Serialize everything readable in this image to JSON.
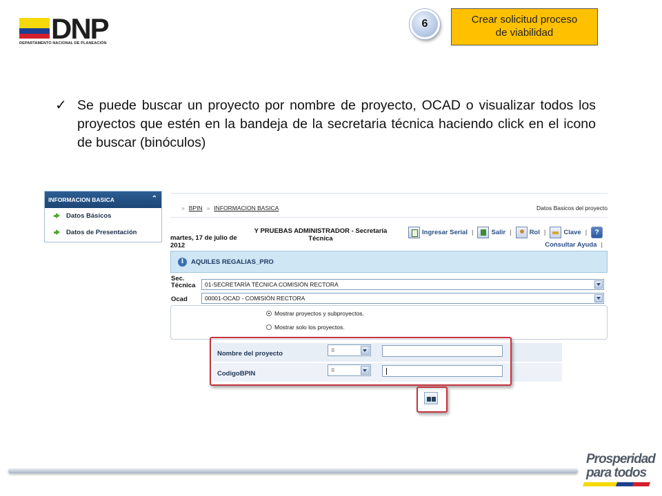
{
  "header": {
    "logo_text": "DNP",
    "logo_subtitle": "DEPARTAMENTO NACIONAL DE PLANEACIÓN",
    "step_number": "6",
    "step_title_line1": "Crear solicitud proceso",
    "step_title_line2": "de viabilidad"
  },
  "bullet": {
    "text": "Se puede buscar un proyecto por nombre de proyecto, OCAD o visualizar todos los proyectos que estén en la bandeja de la secretaria técnica haciendo click en el icono de buscar (binóculos)"
  },
  "sidebar": {
    "header": "INFORMACION BASICA",
    "collapse_glyph": "⌃",
    "items": [
      {
        "label": "Datos Básicos"
      },
      {
        "label": "Datos de Presentación"
      }
    ]
  },
  "app": {
    "breadcrumb": [
      "BPIN",
      "INFORMACION BASICA"
    ],
    "breadcrumb_sep": "»",
    "page_title": "Datos Basicos del proyecto",
    "date_line1": "martes, 17 de julio de",
    "date_line2": "2012",
    "user_line1": "Y PRUEBAS ADMINISTRADOR - Secretaría",
    "user_line2": "Técnica",
    "toolbar": {
      "ingresar_serial": "Ingresar Serial",
      "salir": "Salir",
      "rol": "Rol",
      "clave": "Clave",
      "separator": "|",
      "consultar_ayuda": "Consultar Ayuda"
    },
    "info_bar": "AQUILES REGALIAS_PRO",
    "sec_tecnica_label_1": "Sec.",
    "sec_tecnica_label_2": "Técnica",
    "sec_tecnica_value": "01-SECRETARÍA TÉCNICA COMISIÓN RECTORA",
    "ocad_label": "Ocad",
    "ocad_value": "00001-OCAD - COMISIÓN RECTORA",
    "radio_options": [
      {
        "label": "Mostrar proyectos y subproyectos.",
        "selected": true
      },
      {
        "label": "Mostrar solo los proyectos.",
        "selected": false
      }
    ],
    "search_rows": [
      {
        "label": "Nombre del proyecto",
        "operator": "=",
        "value": ""
      },
      {
        "label": "CodigoBPIN",
        "operator": "=",
        "value": ""
      }
    ]
  },
  "footer": {
    "logo_line1": "Prosperidad",
    "logo_line2": "para todos"
  },
  "colors": {
    "step_box": "#ffc000",
    "highlight_frame": "#c3343c",
    "sidebar_header": "#1c4676",
    "info_bar": "#cfe6f5"
  }
}
